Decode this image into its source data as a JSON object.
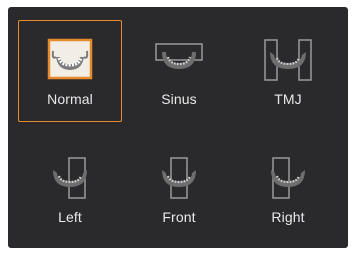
{
  "presets": [
    {
      "label": "Normal",
      "icon": "jaw-normal-icon"
    },
    {
      "label": "Sinus",
      "icon": "jaw-sinus-icon"
    },
    {
      "label": "TMJ",
      "icon": "jaw-tmj-icon"
    },
    {
      "label": "Left",
      "icon": "jaw-left-icon"
    },
    {
      "label": "Front",
      "icon": "jaw-front-icon"
    },
    {
      "label": "Right",
      "icon": "jaw-right-icon"
    }
  ],
  "selected": "Normal",
  "colors": {
    "panel": "#2a2a2c",
    "selected_border": "#e58b2d",
    "icon_frame": "#9a9a9a",
    "icon_jaw": "#8a8a8a",
    "label": "#e9e9e9"
  }
}
